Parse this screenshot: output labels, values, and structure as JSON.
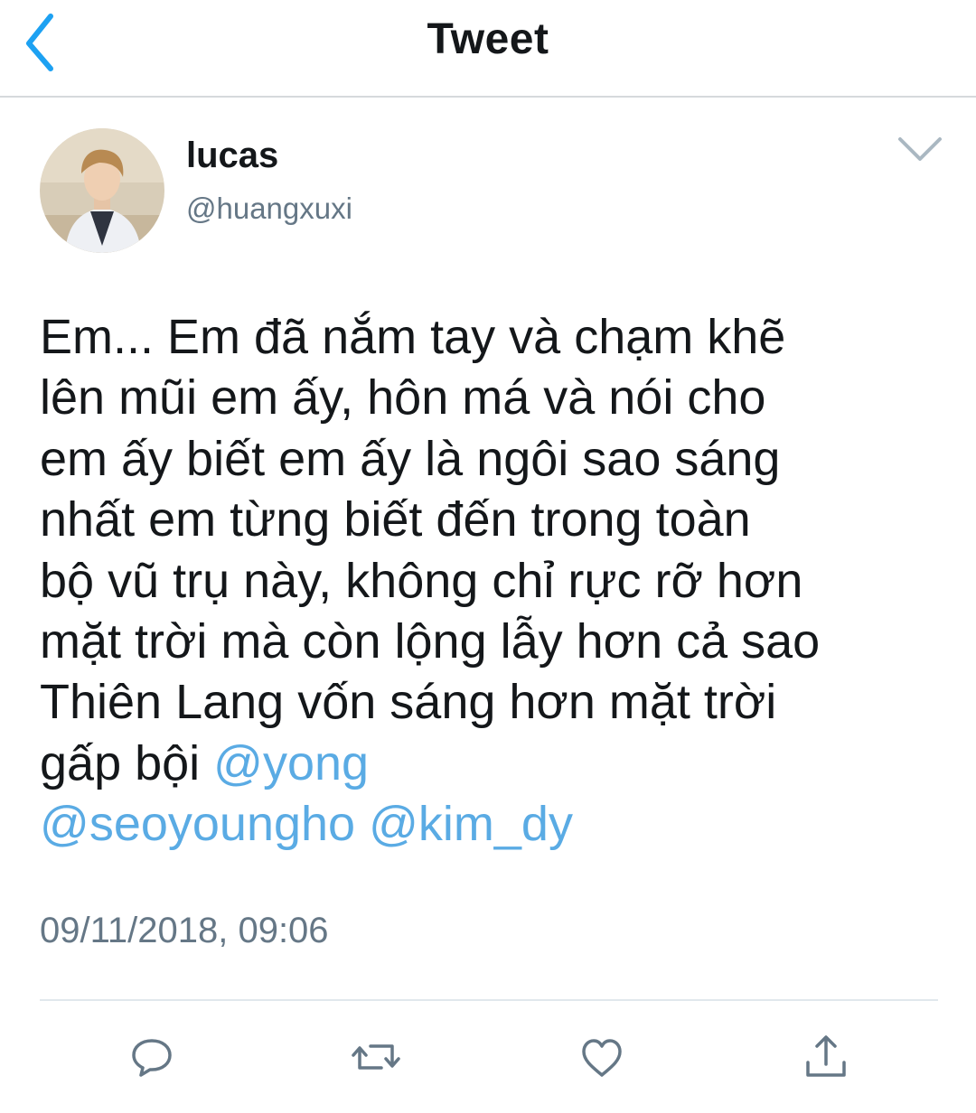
{
  "header": {
    "title": "Tweet",
    "back_icon": "chevron-left-icon"
  },
  "tweet": {
    "author": {
      "display_name": "lucas",
      "handle": "@huangxuxi"
    },
    "text_lines": [
      "Em... Em đã nắm tay và chạm khẽ",
      "lên mũi em ấy, hôn má và nói cho",
      "em ấy biết em ấy là ngôi sao sáng",
      "nhất em từng biết đến trong toàn",
      "bộ vũ trụ này, không chỉ rực rỡ hơn",
      "mặt trời mà còn lộng lẫy hơn cả sao",
      "Thiên Lang vốn sáng hơn mặt trời",
      "gấp bội "
    ],
    "mentions": [
      "@yong",
      "@seoyoungho",
      "@kim_dy"
    ],
    "timestamp": "09/11/2018, 09:06"
  },
  "actions": [
    {
      "name": "reply",
      "icon": "reply-icon"
    },
    {
      "name": "retweet",
      "icon": "retweet-icon"
    },
    {
      "name": "like",
      "icon": "heart-icon"
    },
    {
      "name": "share",
      "icon": "share-icon"
    }
  ],
  "colors": {
    "accent": "#1da1f2",
    "mention": "#5aabe4",
    "secondary_text": "#657786",
    "icon": "#657786",
    "divider": "#e1e8ed"
  }
}
